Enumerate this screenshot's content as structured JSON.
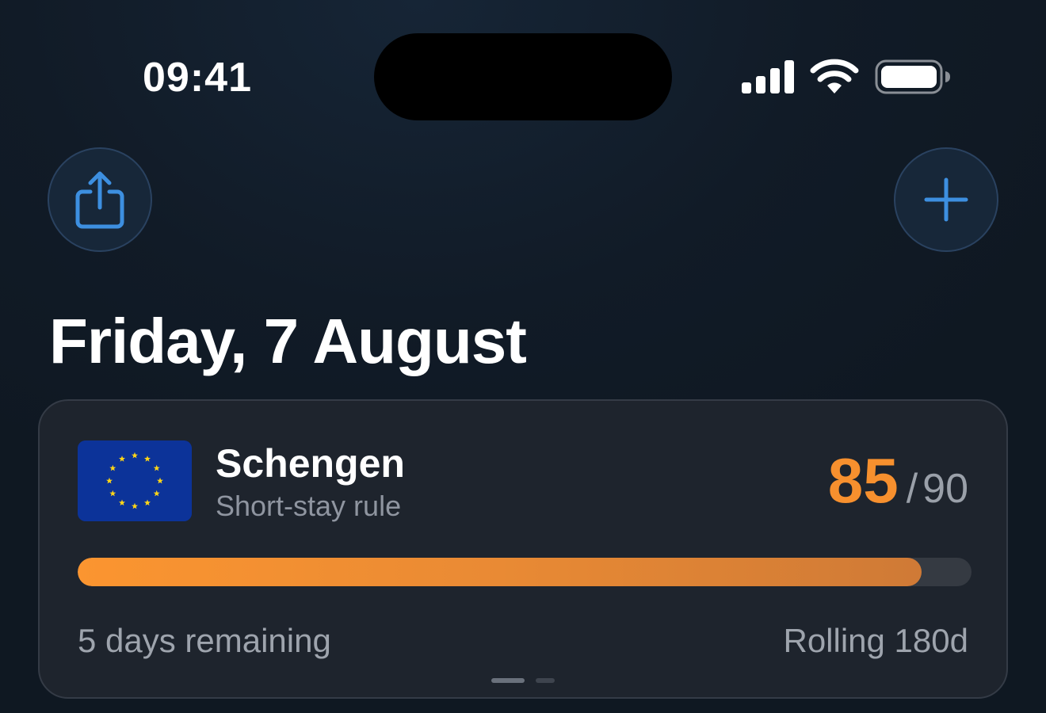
{
  "status_bar": {
    "time": "09:41",
    "icons": [
      "cellular-signal-icon",
      "wifi-icon",
      "battery-icon"
    ]
  },
  "toolbar": {
    "share_icon": "share-icon",
    "add_icon": "plus-icon"
  },
  "header": {
    "date_title": "Friday, 7 August"
  },
  "card": {
    "flag": "eu-flag-icon",
    "title": "Schengen",
    "subtitle": "Short-stay rule",
    "days_used": "85",
    "separator": "/",
    "days_max": "90",
    "progress_fraction": 0.944,
    "remaining_label": "5 days remaining",
    "window_label": "Rolling 180d",
    "page_indicator": {
      "total": 2,
      "active": 1
    }
  },
  "colors": {
    "accent_orange": "#f7902e",
    "accent_blue": "#3d8fe0",
    "card_bg": "#1e242d",
    "eu_blue": "#0c3399",
    "eu_yellow": "#ffd617"
  }
}
